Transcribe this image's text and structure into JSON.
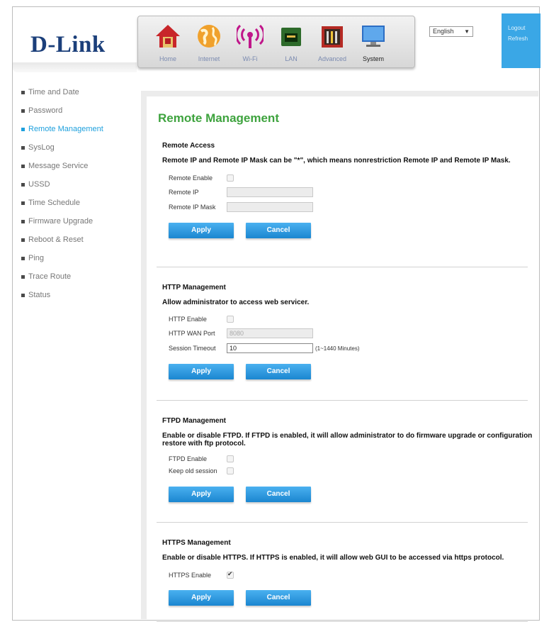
{
  "brand": {
    "logo": "D-Link"
  },
  "nav": {
    "items": [
      {
        "label": "Home",
        "icon": "home-icon"
      },
      {
        "label": "Internet",
        "icon": "globe-icon"
      },
      {
        "label": "Wi-Fi",
        "icon": "wifi-icon"
      },
      {
        "label": "LAN",
        "icon": "lan-icon"
      },
      {
        "label": "Advanced",
        "icon": "toolbox-icon"
      },
      {
        "label": "System",
        "icon": "monitor-icon"
      }
    ],
    "active": "System"
  },
  "language": {
    "selected": "English"
  },
  "top_right": {
    "logout": "Logout",
    "refresh": "Refresh",
    "color": "#3aa7e6"
  },
  "sidebar": {
    "items": [
      {
        "label": "Time and Date"
      },
      {
        "label": "Password"
      },
      {
        "label": "Remote Management"
      },
      {
        "label": "SysLog"
      },
      {
        "label": "Message Service"
      },
      {
        "label": "USSD"
      },
      {
        "label": "Time Schedule"
      },
      {
        "label": "Firmware Upgrade"
      },
      {
        "label": "Reboot & Reset"
      },
      {
        "label": "Ping"
      },
      {
        "label": "Trace Route"
      },
      {
        "label": "Status"
      }
    ],
    "active_color": "#1ea0dd"
  },
  "page": {
    "title": "Remote Management",
    "title_color": "#3ea33e"
  },
  "remote_access": {
    "title": "Remote Access",
    "desc": "Remote IP and Remote IP Mask can be \"*\", which means nonrestriction Remote IP and Remote IP Mask.",
    "enable_label": "Remote Enable",
    "enable_checked": false,
    "ip_label": "Remote IP",
    "ip_value": "",
    "mask_label": "Remote IP Mask",
    "mask_value": "",
    "apply": "Apply",
    "cancel": "Cancel"
  },
  "http": {
    "title": "HTTP Management",
    "desc": "Allow administrator to access web servicer.",
    "enable_label": "HTTP Enable",
    "enable_checked": false,
    "port_label": "HTTP WAN Port",
    "port_value": "8080",
    "timeout_label": "Session Timeout",
    "timeout_value": "10",
    "timeout_hint": "(1~1440 Minutes)",
    "apply": "Apply",
    "cancel": "Cancel"
  },
  "ftpd": {
    "title": "FTPD Management",
    "desc": "Enable or disable FTPD. If FTPD is enabled, it will allow administrator to do firmware upgrade or configuration restore with ftp protocol.",
    "enable_label": "FTPD Enable",
    "enable_checked": false,
    "keep_label": "Keep old session",
    "keep_checked": false,
    "apply": "Apply",
    "cancel": "Cancel"
  },
  "https": {
    "title": "HTTPS Management",
    "desc": "Enable or disable HTTPS. If HTTPS is enabled, it will allow web GUI to be accessed via https protocol.",
    "enable_label": "HTTPS Enable",
    "enable_checked": true,
    "apply": "Apply",
    "cancel": "Cancel"
  },
  "colors": {
    "button": "#2a9ae3",
    "accent_green": "#3ea33e"
  }
}
